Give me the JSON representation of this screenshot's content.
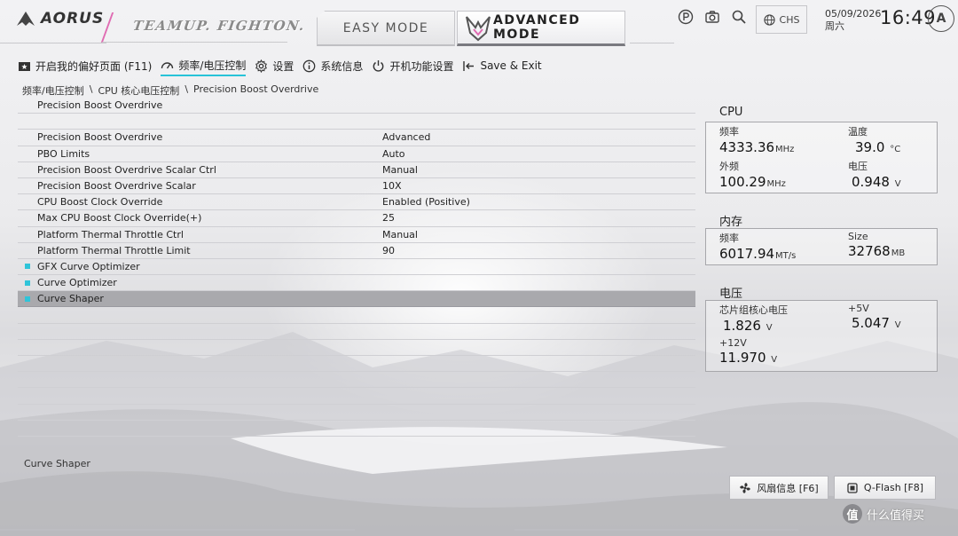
{
  "header": {
    "logo_text": "AORUS",
    "slogan": "TEAMUP. FIGHTON.",
    "easy_mode": "EASY MODE",
    "advanced_mode": "ADVANCED MODE",
    "language": "CHS",
    "date": "05/09/2026",
    "weekday": "周六",
    "time": "16:49",
    "a_icon_letter": "A"
  },
  "menu": [
    {
      "label": "开启我的偏好页面 (F11)",
      "icon": "star-folder-icon"
    },
    {
      "label": "频率/电压控制",
      "icon": "gauge-icon",
      "active": true
    },
    {
      "label": "设置",
      "icon": "gear-icon"
    },
    {
      "label": "系统信息",
      "icon": "info-icon"
    },
    {
      "label": "开机功能设置",
      "icon": "power-icon"
    },
    {
      "label": "Save & Exit",
      "icon": "exit-arrow-icon"
    }
  ],
  "breadcrumb": [
    "频率/电压控制",
    "\\",
    "CPU 核心电压控制",
    "\\",
    "Precision Boost Overdrive"
  ],
  "panel": {
    "title": "Precision Boost Overdrive",
    "rows": [
      {
        "label": "Precision Boost Overdrive",
        "value": "Advanced"
      },
      {
        "label": "PBO Limits",
        "value": "Auto"
      },
      {
        "label": "Precision Boost Overdrive Scalar Ctrl",
        "value": "Manual"
      },
      {
        "label": "Precision Boost Overdrive Scalar",
        "value": "10X"
      },
      {
        "label": "CPU Boost Clock Override",
        "value": "Enabled (Positive)"
      },
      {
        "label": "Max CPU Boost Clock Override(+)",
        "value": "25"
      },
      {
        "label": "Platform Thermal Throttle Ctrl",
        "value": "Manual"
      },
      {
        "label": "Platform Thermal Throttle Limit",
        "value": "90"
      }
    ],
    "submenus": [
      {
        "label": "GFX Curve Optimizer"
      },
      {
        "label": "Curve Optimizer"
      },
      {
        "label": "Curve Shaper",
        "selected": true
      }
    ],
    "help_text": "Curve Shaper"
  },
  "monitor": {
    "cpu": {
      "title": "CPU",
      "freq_label": "频率",
      "freq_value": "4333.36",
      "freq_unit": "MHz",
      "temp_label": "温度",
      "temp_value": "39.0",
      "temp_unit": "°C",
      "bclk_label": "外频",
      "bclk_value": "100.29",
      "bclk_unit": "MHz",
      "volt_label": "电压",
      "volt_value": "0.948",
      "volt_unit": "V"
    },
    "memory": {
      "title": "内存",
      "freq_label": "频率",
      "freq_value": "6017.94",
      "freq_unit": "MT/s",
      "size_label": "Size",
      "size_value": "32768",
      "size_unit": "MB"
    },
    "voltage": {
      "title": "电压",
      "chipset_label": "芯片组核心电压",
      "chipset_value": "1.826",
      "chipset_unit": "V",
      "v5_label": "+5V",
      "v5_value": "5.047",
      "v5_unit": "V",
      "v12_label": "+12V",
      "v12_value": "11.970",
      "v12_unit": "V"
    }
  },
  "buttons": {
    "fan": "风扇信息 [F6]",
    "qflash": "Q-Flash [F8]"
  },
  "watermark": {
    "circle": "值",
    "text": "什么值得买"
  },
  "colors": {
    "accent_cyan": "#27c3d8",
    "accent_pink": "#e06bb2",
    "selected_row": "#a9a9ad"
  }
}
